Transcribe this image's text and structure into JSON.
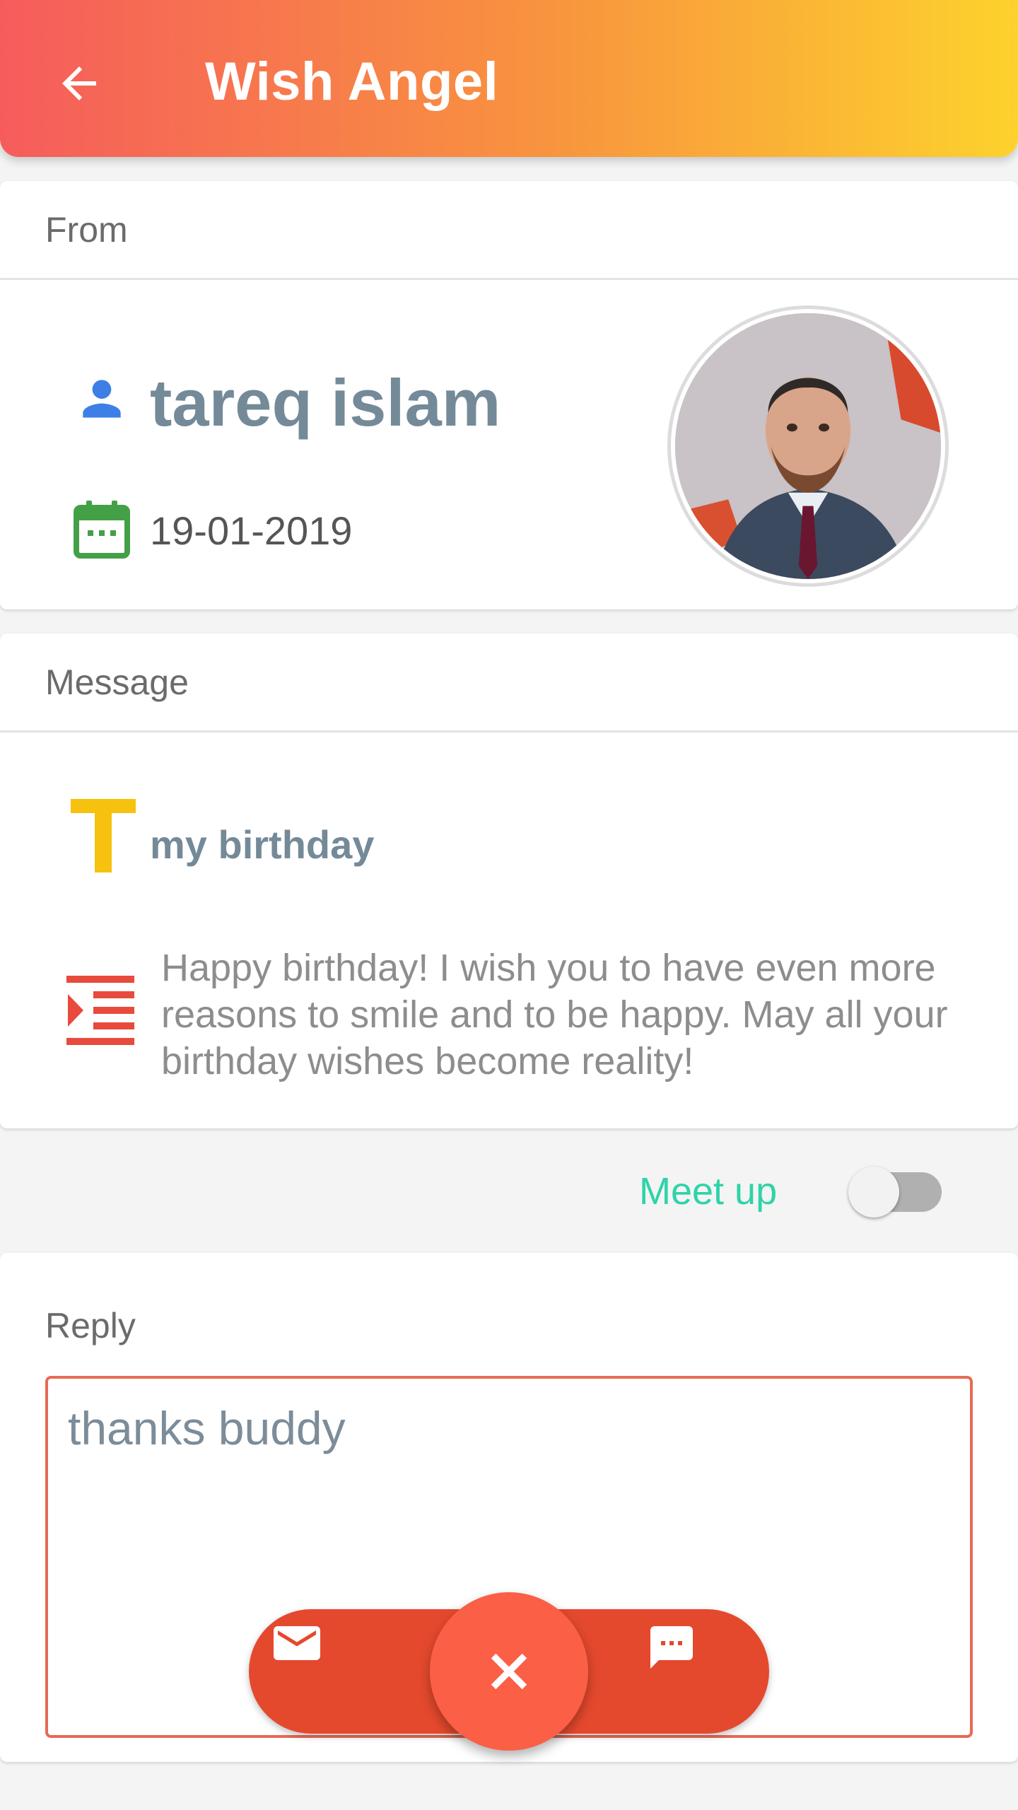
{
  "app_bar": {
    "title": "Wish Angel",
    "back_icon": "arrow-left-icon",
    "gradient": [
      "#f65c5c",
      "#f8953e",
      "#fdd22d"
    ]
  },
  "from_section": {
    "header": "From",
    "sender_name": "tareq islam",
    "date": "19-01-2019",
    "person_icon": "person-icon",
    "calendar_icon": "calendar-icon",
    "avatar": "sender-photo"
  },
  "message_section": {
    "header": "Message",
    "title": "my birthday",
    "body": "Happy birthday! I wish you to have even more reasons to smile and to be happy. May all your birthday wishes become reality!",
    "title_icon": "text-title-icon",
    "body_icon": "text-body-icon"
  },
  "meetup": {
    "label": "Meet up",
    "enabled": false,
    "label_color": "#2ed3a9"
  },
  "reply_section": {
    "header": "Reply",
    "value": "thanks buddy"
  },
  "actions": {
    "mail_icon": "mail-icon",
    "close_icon": "close-icon",
    "chat_icon": "chat-icon",
    "accent": "#e4492d",
    "fab_color": "#fb5f46"
  }
}
